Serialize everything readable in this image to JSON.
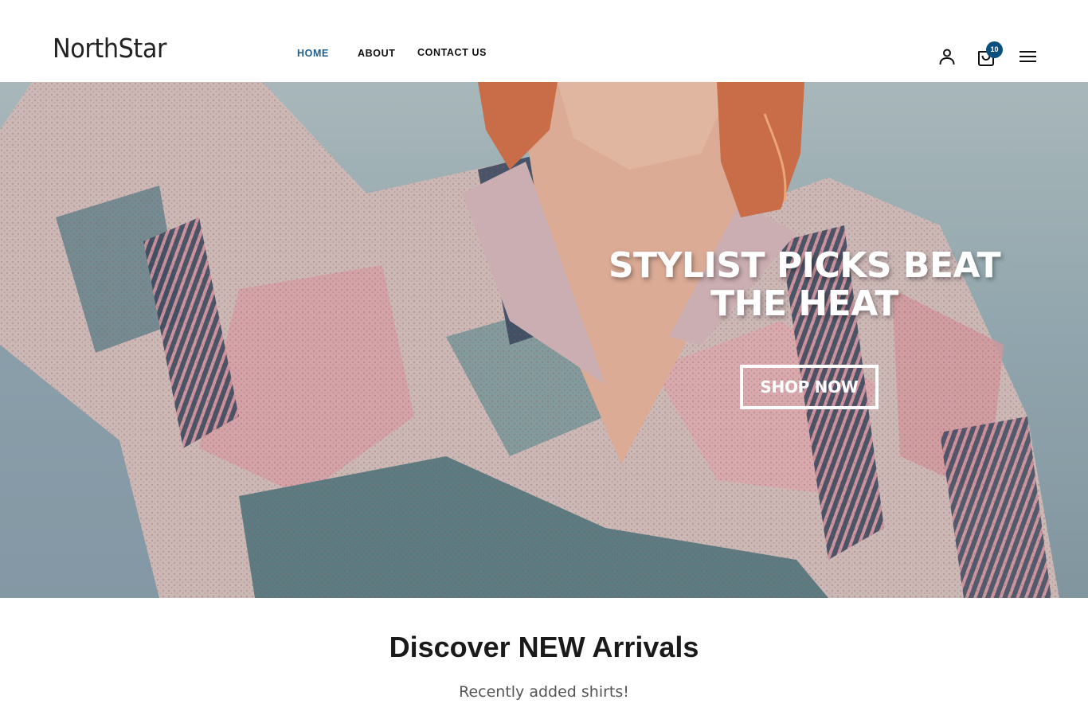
{
  "header": {
    "logo": "NorthStar",
    "nav": [
      {
        "label": "HOME",
        "active": true
      },
      {
        "label": "ABOUT",
        "active": false
      },
      {
        "label": "CONTACT US",
        "active": false
      }
    ],
    "icons": [
      "user-icon",
      "shopping-bag-icon",
      "menu-icon"
    ],
    "cart_count": "10"
  },
  "hero": {
    "title_line1": "STYLIST PICKS BEAT",
    "title_line2": "THE HEAT",
    "button_label": "SHOP NOW"
  },
  "section": {
    "title": "Discover NEW Arrivals",
    "subtitle": "Recently added shirts!"
  },
  "colors": {
    "accent": "#1f5e8c",
    "badge": "#0b4f7e",
    "text": "#111111"
  }
}
